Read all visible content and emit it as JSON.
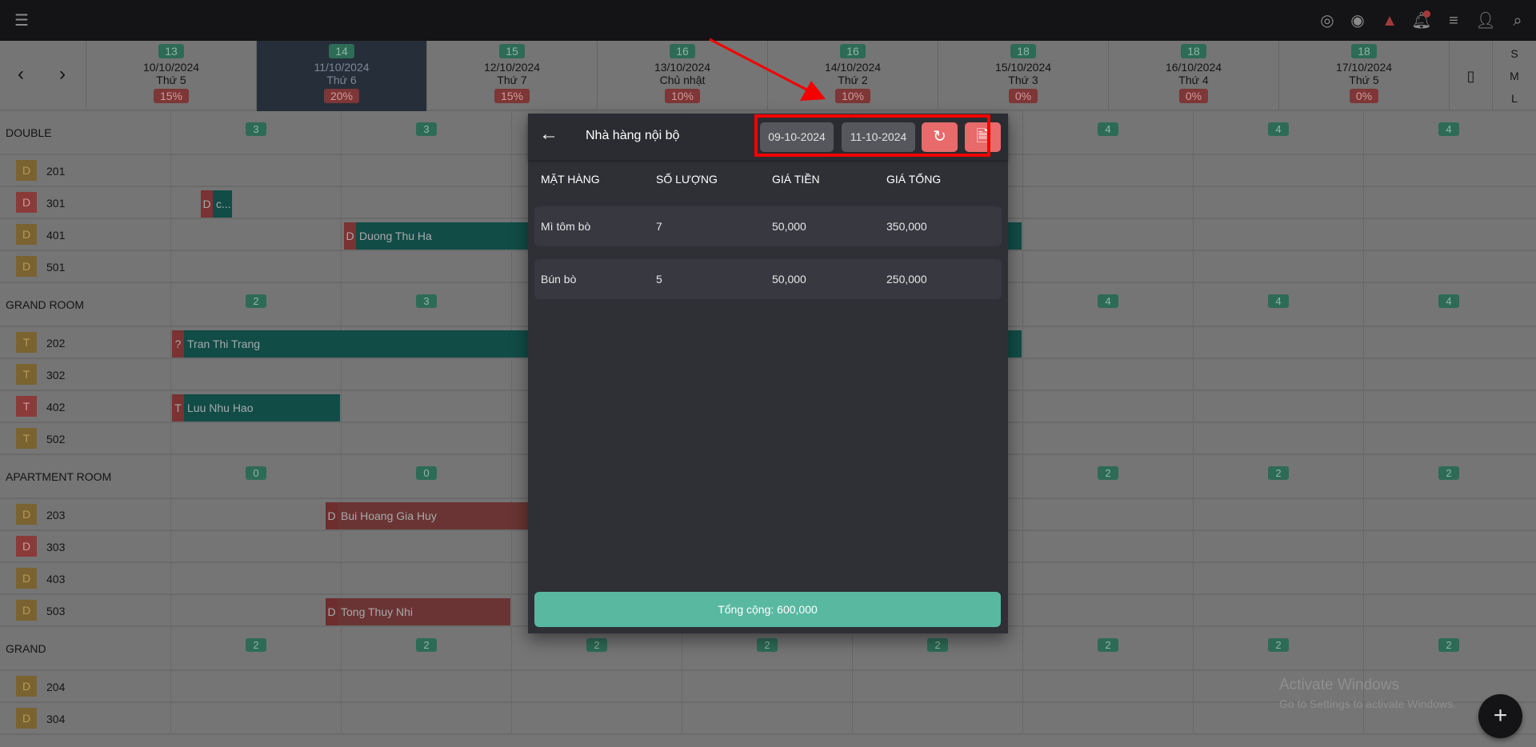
{
  "topbar": {
    "icons": [
      "menu-icon",
      "fingerprint-icon",
      "eye-icon",
      "warning-icon",
      "bell-icon",
      "list-icon",
      "add-user-icon",
      "search-icon"
    ],
    "accent_warning": "#a33a3a"
  },
  "nav": {
    "prev": "‹",
    "next": "›"
  },
  "days": [
    {
      "num": "13",
      "date": "10/10/2024",
      "weekday": "Thứ 5",
      "pct": "15%"
    },
    {
      "num": "14",
      "date": "11/10/2024",
      "weekday": "Thứ 6",
      "pct": "20%",
      "selected": true
    },
    {
      "num": "15",
      "date": "12/10/2024",
      "weekday": "Thứ 7",
      "pct": "15%"
    },
    {
      "num": "16",
      "date": "13/10/2024",
      "weekday": "Chủ nhật",
      "pct": "10%"
    },
    {
      "num": "16",
      "date": "14/10/2024",
      "weekday": "Thứ 2",
      "pct": "10%"
    },
    {
      "num": "18",
      "date": "15/10/2024",
      "weekday": "Thứ 3",
      "pct": "0%"
    },
    {
      "num": "18",
      "date": "16/10/2024",
      "weekday": "Thứ 4",
      "pct": "0%"
    },
    {
      "num": "18",
      "date": "17/10/2024",
      "weekday": "Thứ 5",
      "pct": "0%"
    }
  ],
  "sizes": [
    "S",
    "M",
    "L"
  ],
  "groups": [
    {
      "name": "DOUBLE",
      "counts": [
        "3",
        "3",
        "",
        "",
        "",
        "4",
        "4",
        "4"
      ],
      "rooms": [
        {
          "type": "D",
          "num": "201",
          "status": "yellow"
        },
        {
          "type": "D",
          "num": "301",
          "status": "red"
        },
        {
          "type": "D",
          "num": "401",
          "status": "yellow"
        },
        {
          "type": "D",
          "num": "501",
          "status": "yellow"
        }
      ]
    },
    {
      "name": "GRAND ROOM",
      "counts": [
        "2",
        "3",
        "",
        "",
        "",
        "4",
        "4",
        "4"
      ],
      "rooms": [
        {
          "type": "T",
          "num": "202",
          "status": "yellow"
        },
        {
          "type": "T",
          "num": "302",
          "status": "yellow"
        },
        {
          "type": "T",
          "num": "402",
          "status": "red"
        },
        {
          "type": "T",
          "num": "502",
          "status": "yellow"
        }
      ]
    },
    {
      "name": "APARTMENT ROOM",
      "counts": [
        "0",
        "0",
        "",
        "",
        "",
        "2",
        "2",
        "2"
      ],
      "rooms": [
        {
          "type": "D",
          "num": "203",
          "status": "yellow"
        },
        {
          "type": "D",
          "num": "303",
          "status": "red"
        },
        {
          "type": "D",
          "num": "403",
          "status": "yellow"
        },
        {
          "type": "D",
          "num": "503",
          "status": "yellow"
        }
      ]
    },
    {
      "name": "GRAND",
      "counts": [
        "2",
        "2",
        "2",
        "2",
        "2",
        "2",
        "2",
        "2"
      ],
      "rooms": [
        {
          "type": "D",
          "num": "204",
          "status": "yellow"
        },
        {
          "type": "D",
          "num": "304",
          "status": "yellow"
        }
      ]
    }
  ],
  "bookings": [
    {
      "room": "301",
      "tag": "D",
      "guest": "c...",
      "color": "teal"
    },
    {
      "room": "401",
      "tag": "D",
      "guest": "Duong Thu Ha",
      "color": "teal"
    },
    {
      "room": "202",
      "tag": "?",
      "guest": "Tran Thi Trang",
      "color": "teal"
    },
    {
      "room": "402",
      "tag": "T",
      "guest": "Luu Nhu Hao",
      "color": "teal"
    },
    {
      "room": "203",
      "tag": "D",
      "guest": "Bui Hoang Gia Huy",
      "color": "red"
    },
    {
      "room": "503",
      "tag": "D",
      "guest": "Tong Thuy Nhi",
      "color": "red"
    }
  ],
  "modal": {
    "title": "Nhà hàng nội bộ",
    "from_date": "09-10-2024",
    "to_date": "11-10-2024",
    "columns": [
      "MẶT HÀNG",
      "SỐ LƯỢNG",
      "GIÁ TIỀN",
      "GIÁ TỔNG"
    ],
    "rows": [
      [
        "Mì tôm bò",
        "7",
        "50,000",
        "350,000"
      ],
      [
        "Bún bò",
        "5",
        "50,000",
        "250,000"
      ]
    ],
    "total": "Tổng cộng: 600,000"
  },
  "watermark": {
    "title": "Activate Windows",
    "subtitle": "Go to Settings to activate Windows."
  },
  "colors": {
    "highlight": "#f40000",
    "total_button": "#58b8a0",
    "refresh_button": "#e86a6a"
  }
}
